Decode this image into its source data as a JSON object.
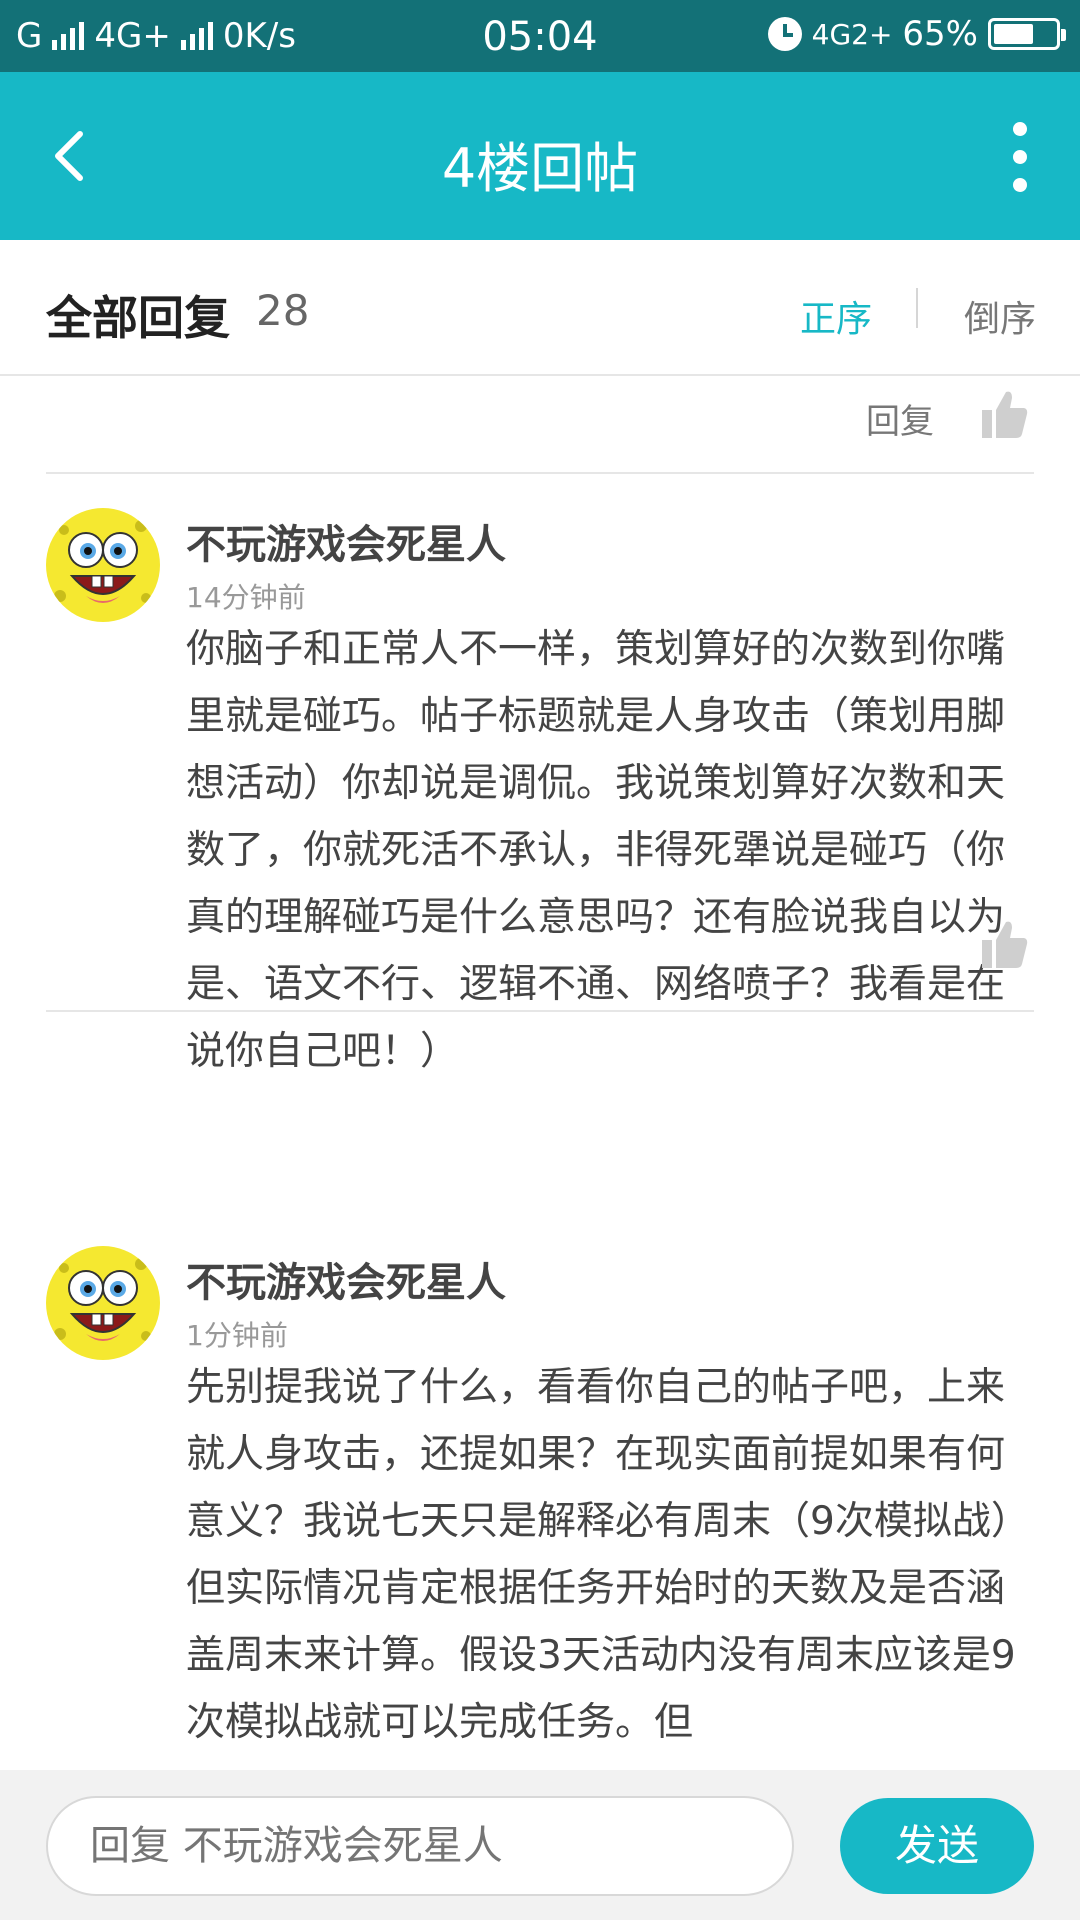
{
  "status_bar": {
    "carrier1": "G",
    "network": "4G+",
    "speed": "0K/s",
    "time": "05:04",
    "network2": "4G2+",
    "battery_percent": "65%",
    "battery_level": 0.65
  },
  "header": {
    "title": "4楼回帖",
    "back_icon": "chevron-left-icon",
    "more_icon": "more-vertical-icon"
  },
  "replies": {
    "title": "全部回复",
    "count": "28",
    "sort_asc": "正序",
    "sort_desc": "倒序"
  },
  "prev_post_actions": {
    "reply_label": "回复"
  },
  "posts": [
    {
      "username": "不玩游戏会死星人",
      "time": "14分钟前",
      "text": "你脑子和正常人不一样，策划算好的次数到你嘴里就是碰巧。帖子标题就是人身攻击（策划用脚想活动）你却说是调侃。我说策划算好次数和天数了，你就死活不承认，非得死犟说是碰巧（你真的理解碰巧是什么意思吗？还有脸说我自以为是、语文不行、逻辑不通、网络喷子？我看是在说你自己吧！）"
    },
    {
      "username": "不玩游戏会死星人",
      "time": "1分钟前",
      "text": "先别提我说了什么，看看你自己的帖子吧，上来就人身攻击，还提如果？在现实面前提如果有何意义？我说七天只是解释必有周末（9次模拟战）但实际情况肯定根据任务开始时的天数及是否涵盖周末来计算。假设3天活动内没有周末应该是9次模拟战就可以完成任务。但"
    }
  ],
  "bottom_bar": {
    "input_placeholder": "回复 不玩游戏会死星人",
    "send_label": "发送"
  },
  "colors": {
    "status_bar": "#137177",
    "accent": "#17b8c6"
  }
}
